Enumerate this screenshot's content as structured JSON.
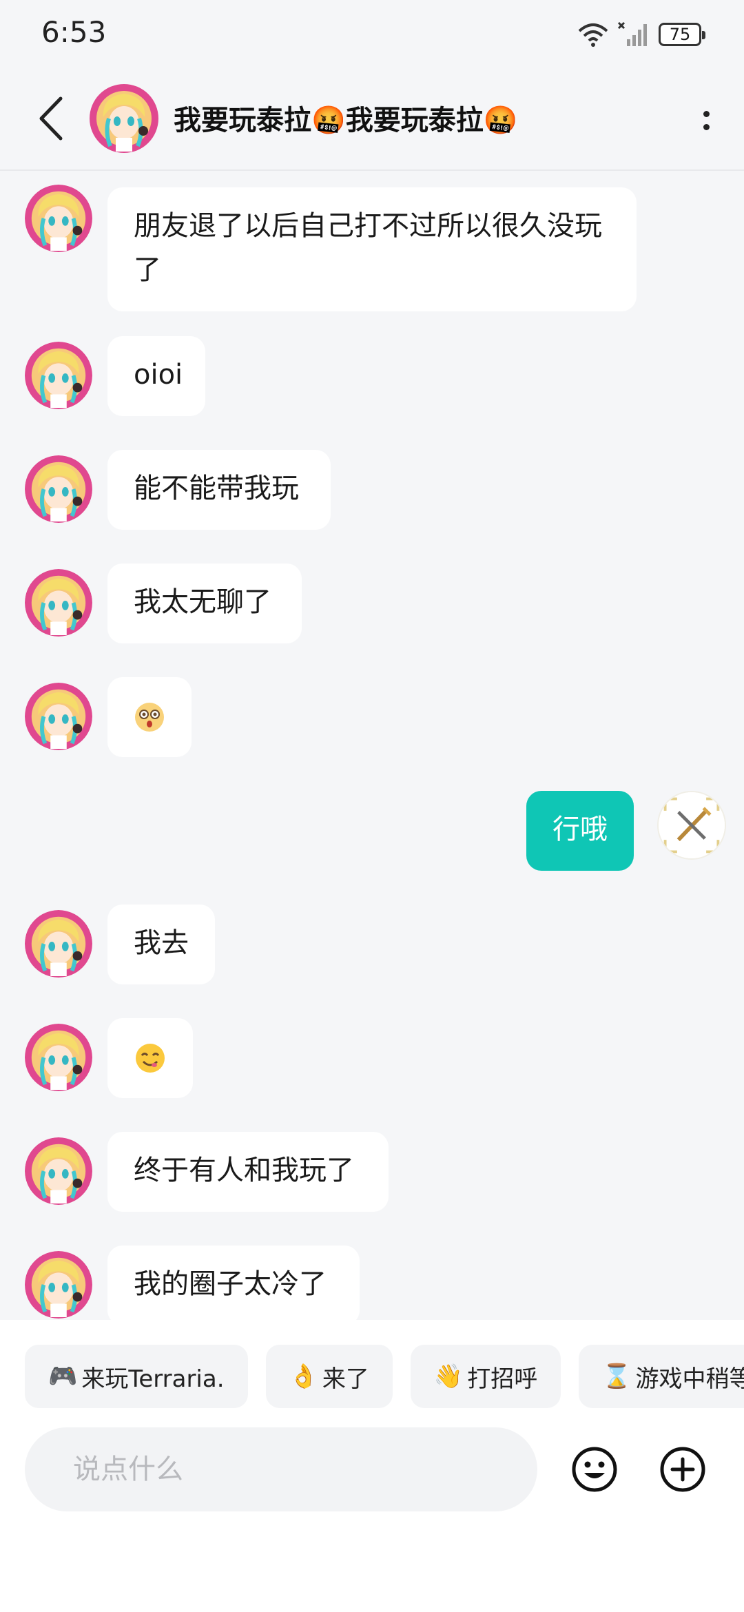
{
  "status_bar": {
    "time": "6:53",
    "battery": "75"
  },
  "header": {
    "title": "我要玩泰拉🤬我要玩泰拉🤬"
  },
  "messages": [
    {
      "side": "in",
      "text": "朋友退了以后自己打不过所以很久没玩了"
    },
    {
      "side": "in",
      "text": "oioi"
    },
    {
      "side": "in",
      "text": "能不能带我玩"
    },
    {
      "side": "in",
      "text": "我太无聊了"
    },
    {
      "side": "in",
      "icon": "dizzy-face-emoji"
    },
    {
      "side": "out",
      "text": "行哦"
    },
    {
      "side": "in",
      "text": "我去"
    },
    {
      "side": "in",
      "icon": "smiling-face-emoji"
    },
    {
      "side": "in",
      "text": "终于有人和我玩了"
    },
    {
      "side": "in",
      "text": "我的圈子太冷了"
    }
  ],
  "quick_replies": [
    {
      "emoji": "🎮",
      "label": " 来玩Terraria."
    },
    {
      "emoji": "👌",
      "label": "来了"
    },
    {
      "emoji": "👋",
      "label": "打招呼"
    },
    {
      "emoji": "⌛",
      "label": "游戏中稍等"
    }
  ],
  "input": {
    "placeholder": "说点什么"
  },
  "colors": {
    "accent": "#0fc6b5",
    "avatar_ring": "#e0488f",
    "background": "#f5f6f8"
  }
}
